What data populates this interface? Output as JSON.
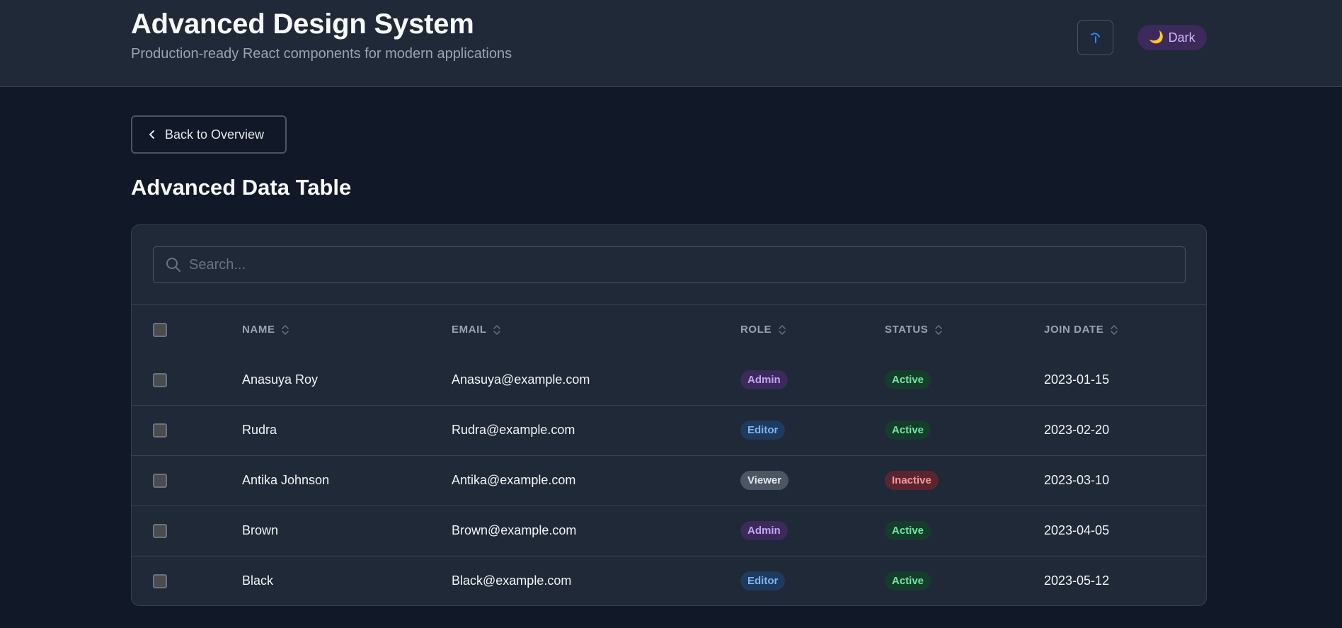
{
  "header": {
    "title": "Advanced Design System",
    "subtitle": "Production-ready React components for modern applications",
    "theme_toggle_label": "Dark",
    "theme_icon": "moon-icon",
    "loader_icon": "spinner-icon"
  },
  "nav": {
    "back_label": "Back to Overview"
  },
  "section": {
    "title": "Advanced Data Table"
  },
  "search": {
    "placeholder": "Search...",
    "value": ""
  },
  "table": {
    "columns": [
      "NAME",
      "EMAIL",
      "ROLE",
      "STATUS",
      "JOIN DATE"
    ],
    "rows": [
      {
        "name": "Anasuya Roy",
        "email": "Anasuya@example.com",
        "role": "Admin",
        "status": "Active",
        "join_date": "2023-01-15"
      },
      {
        "name": "Rudra",
        "email": "Rudra@example.com",
        "role": "Editor",
        "status": "Active",
        "join_date": "2023-02-20"
      },
      {
        "name": "Antika Johnson",
        "email": "Antika@example.com",
        "role": "Viewer",
        "status": "Inactive",
        "join_date": "2023-03-10"
      },
      {
        "name": "Brown",
        "email": "Brown@example.com",
        "role": "Admin",
        "status": "Active",
        "join_date": "2023-04-05"
      },
      {
        "name": "Black",
        "email": "Black@example.com",
        "role": "Editor",
        "status": "Active",
        "join_date": "2023-05-12"
      }
    ]
  },
  "colors": {
    "background": "#111827",
    "surface": "#1f2937",
    "border": "#374151",
    "admin_badge": "#c4a3f7",
    "editor_badge": "#7cb4f5",
    "active_badge": "#6ee7a1",
    "inactive_badge": "#f29b9b"
  }
}
